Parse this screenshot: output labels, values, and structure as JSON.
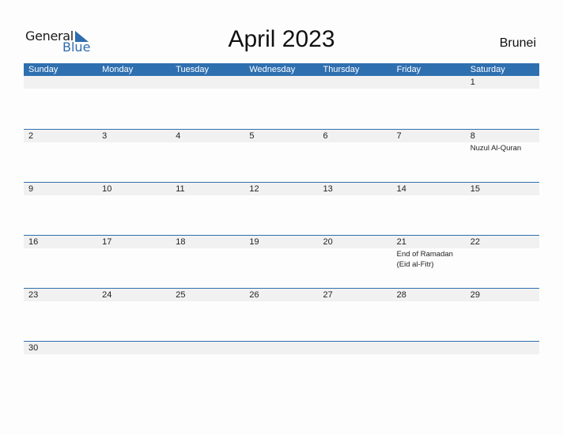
{
  "logo": {
    "word1": "General",
    "word2": "Blue"
  },
  "title": "April 2023",
  "country": "Brunei",
  "colors": {
    "accent": "#2e6fb0",
    "band": "#f1f1f1"
  },
  "days_of_week": [
    "Sunday",
    "Monday",
    "Tuesday",
    "Wednesday",
    "Thursday",
    "Friday",
    "Saturday"
  ],
  "weeks": [
    [
      {
        "day": ""
      },
      {
        "day": ""
      },
      {
        "day": ""
      },
      {
        "day": ""
      },
      {
        "day": ""
      },
      {
        "day": ""
      },
      {
        "day": "1"
      }
    ],
    [
      {
        "day": "2"
      },
      {
        "day": "3"
      },
      {
        "day": "4"
      },
      {
        "day": "5"
      },
      {
        "day": "6"
      },
      {
        "day": "7"
      },
      {
        "day": "8",
        "event": "Nuzul Al-Quran"
      }
    ],
    [
      {
        "day": "9"
      },
      {
        "day": "10"
      },
      {
        "day": "11"
      },
      {
        "day": "12"
      },
      {
        "day": "13"
      },
      {
        "day": "14"
      },
      {
        "day": "15"
      }
    ],
    [
      {
        "day": "16"
      },
      {
        "day": "17"
      },
      {
        "day": "18"
      },
      {
        "day": "19"
      },
      {
        "day": "20"
      },
      {
        "day": "21",
        "event": "End of Ramadan (Eid al-Fitr)"
      },
      {
        "day": "22"
      }
    ],
    [
      {
        "day": "23"
      },
      {
        "day": "24"
      },
      {
        "day": "25"
      },
      {
        "day": "26"
      },
      {
        "day": "27"
      },
      {
        "day": "28"
      },
      {
        "day": "29"
      }
    ],
    [
      {
        "day": "30"
      },
      {
        "day": ""
      },
      {
        "day": ""
      },
      {
        "day": ""
      },
      {
        "day": ""
      },
      {
        "day": ""
      },
      {
        "day": ""
      }
    ]
  ]
}
